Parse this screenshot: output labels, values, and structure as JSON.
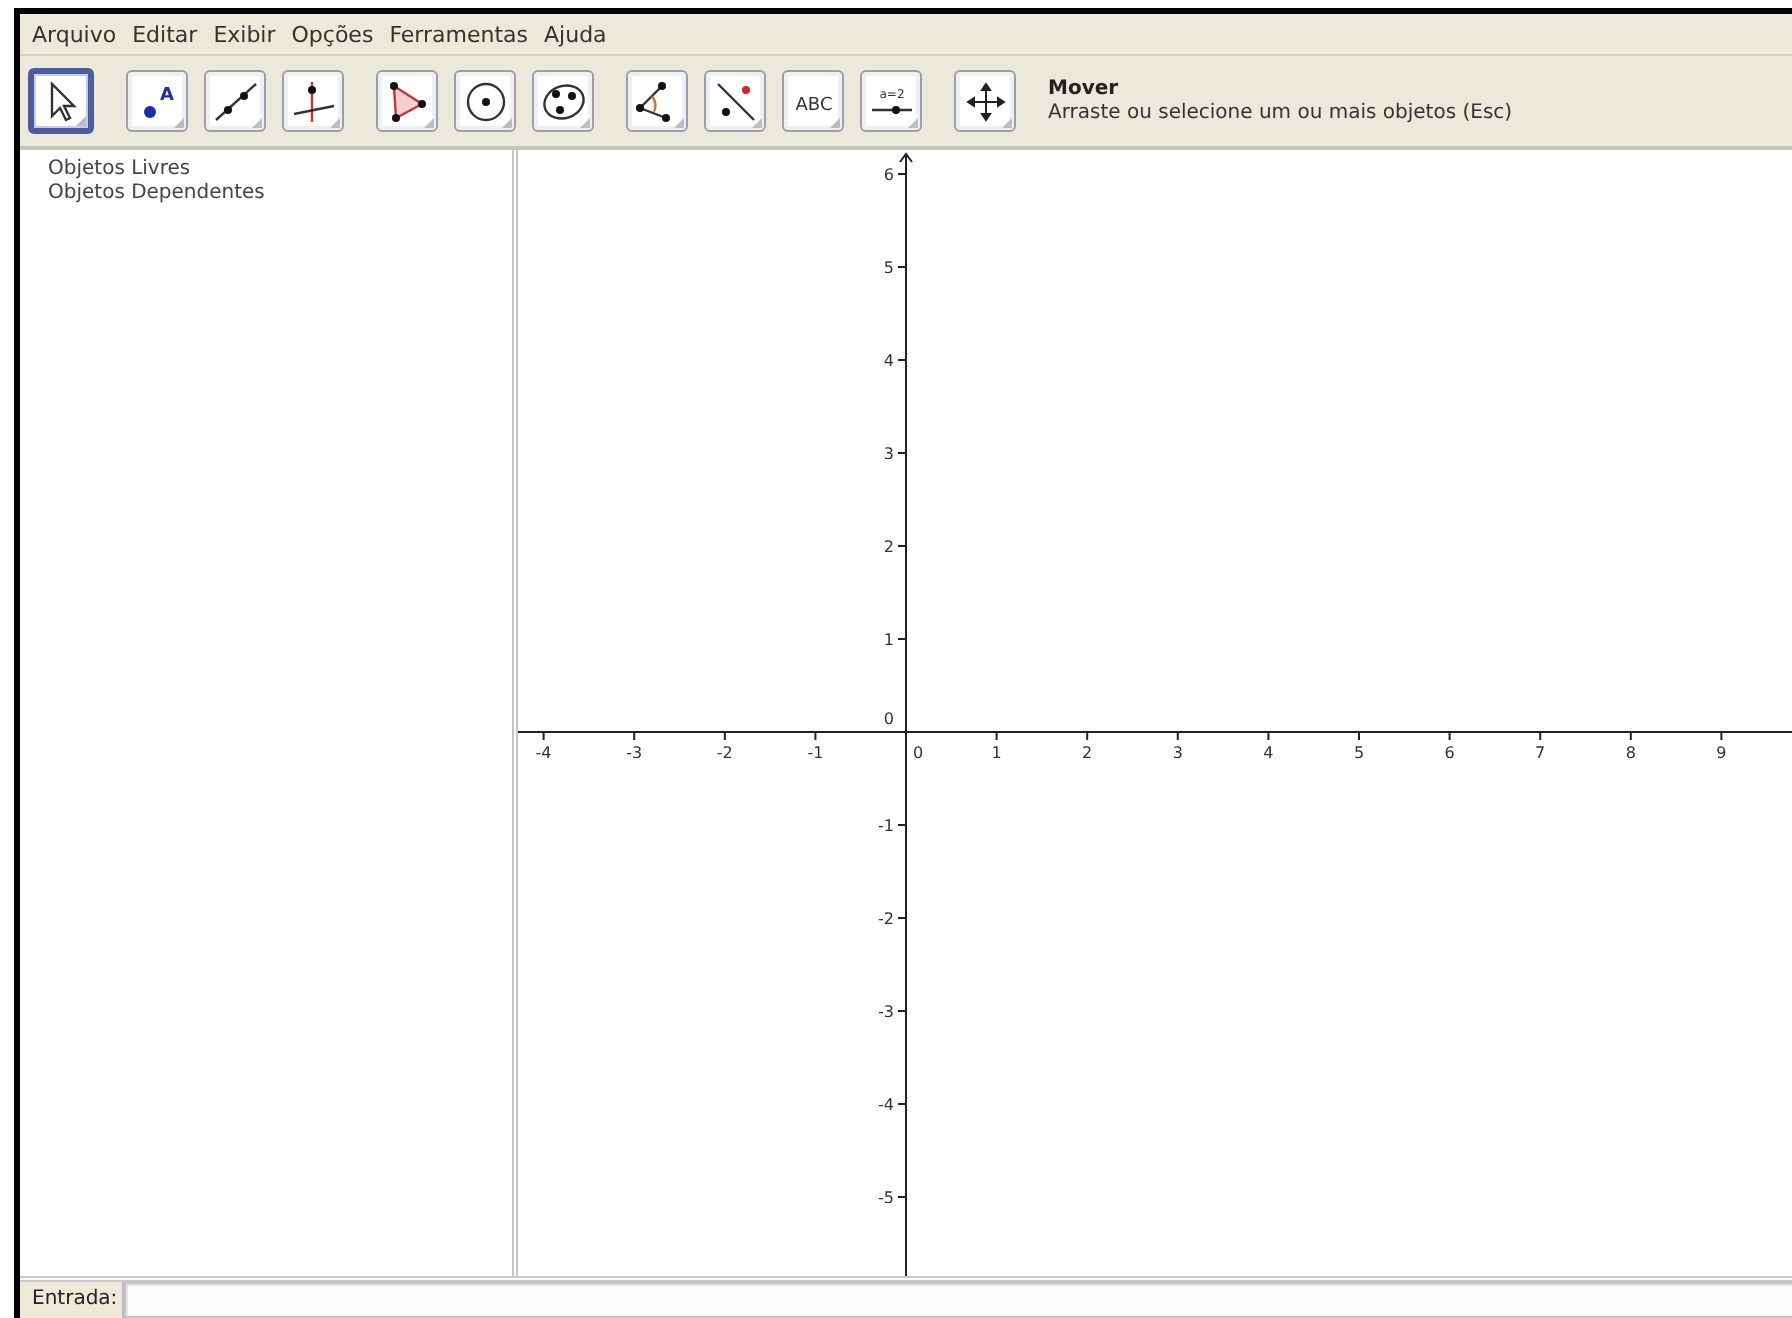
{
  "menu": [
    "Arquivo",
    "Editar",
    "Exibir",
    "Opções",
    "Ferramentas",
    "Ajuda"
  ],
  "toolbar": {
    "groups": [
      [
        {
          "kind": "move",
          "selected": true
        }
      ],
      [
        {
          "kind": "point",
          "label": "A",
          "selected": false
        },
        {
          "kind": "line",
          "selected": false
        },
        {
          "kind": "perpendicular",
          "selected": false
        }
      ],
      [
        {
          "kind": "polygon",
          "selected": false
        },
        {
          "kind": "circle",
          "selected": false
        },
        {
          "kind": "conic",
          "selected": false
        }
      ],
      [
        {
          "kind": "angle",
          "selected": false
        },
        {
          "kind": "reflect",
          "selected": false
        },
        {
          "kind": "text",
          "label": "ABC",
          "selected": false
        },
        {
          "kind": "slider",
          "label": "a=2",
          "selected": false
        }
      ],
      [
        {
          "kind": "pan",
          "selected": false
        }
      ]
    ],
    "tool_name": "Mover",
    "tool_help": "Arraste ou selecione um ou mais objetos (Esc)"
  },
  "algebra": {
    "items": [
      "Objetos Livres",
      "Objetos Dependentes"
    ]
  },
  "graphics": {
    "x_negative": [
      "-4",
      "-3",
      "-2",
      "-1"
    ],
    "x_positive": [
      "0",
      "1",
      "2",
      "3",
      "4",
      "5",
      "6",
      "7",
      "8",
      "9"
    ],
    "y_positive": [
      "6",
      "5",
      "4",
      "3",
      "2",
      "1",
      "0"
    ],
    "y_negative": [
      "-1",
      "-2",
      "-3",
      "-4",
      "-5"
    ]
  },
  "input": {
    "label": "Entrada:"
  }
}
